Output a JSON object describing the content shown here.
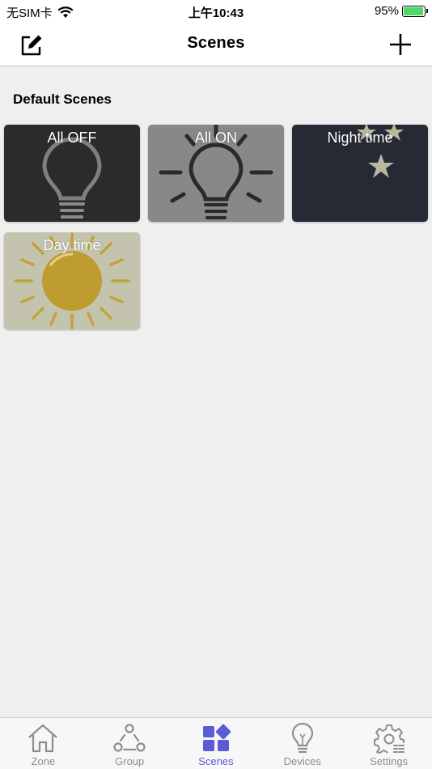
{
  "status_bar": {
    "carrier": "无SIM卡",
    "time": "上午10:43",
    "battery_percent": "95%",
    "battery_level": 0.95
  },
  "nav": {
    "title": "Scenes",
    "edit_icon": "edit-icon",
    "add_icon": "plus-icon"
  },
  "section": {
    "title": "Default Scenes"
  },
  "scenes": [
    {
      "label": "All OFF",
      "icon": "bulb-off-icon",
      "color": "#2b2b2b"
    },
    {
      "label": "All ON",
      "icon": "bulb-on-icon",
      "color": "#888888"
    },
    {
      "label": "Night time",
      "icon": "moon-stars-icon",
      "color": "#262a35"
    },
    {
      "label": "Day time",
      "icon": "sun-icon",
      "color": "#c4c4ae"
    }
  ],
  "tabs": [
    {
      "label": "Zone",
      "icon": "home-icon",
      "active": false
    },
    {
      "label": "Group",
      "icon": "group-icon",
      "active": false
    },
    {
      "label": "Scenes",
      "icon": "scenes-icon",
      "active": true
    },
    {
      "label": "Devices",
      "icon": "bulb-icon",
      "active": false
    },
    {
      "label": "Settings",
      "icon": "settings-icon",
      "active": false
    }
  ],
  "colors": {
    "accent": "#5b5bd6",
    "tab_inactive": "#8e8e8e",
    "background": "#efefef"
  }
}
